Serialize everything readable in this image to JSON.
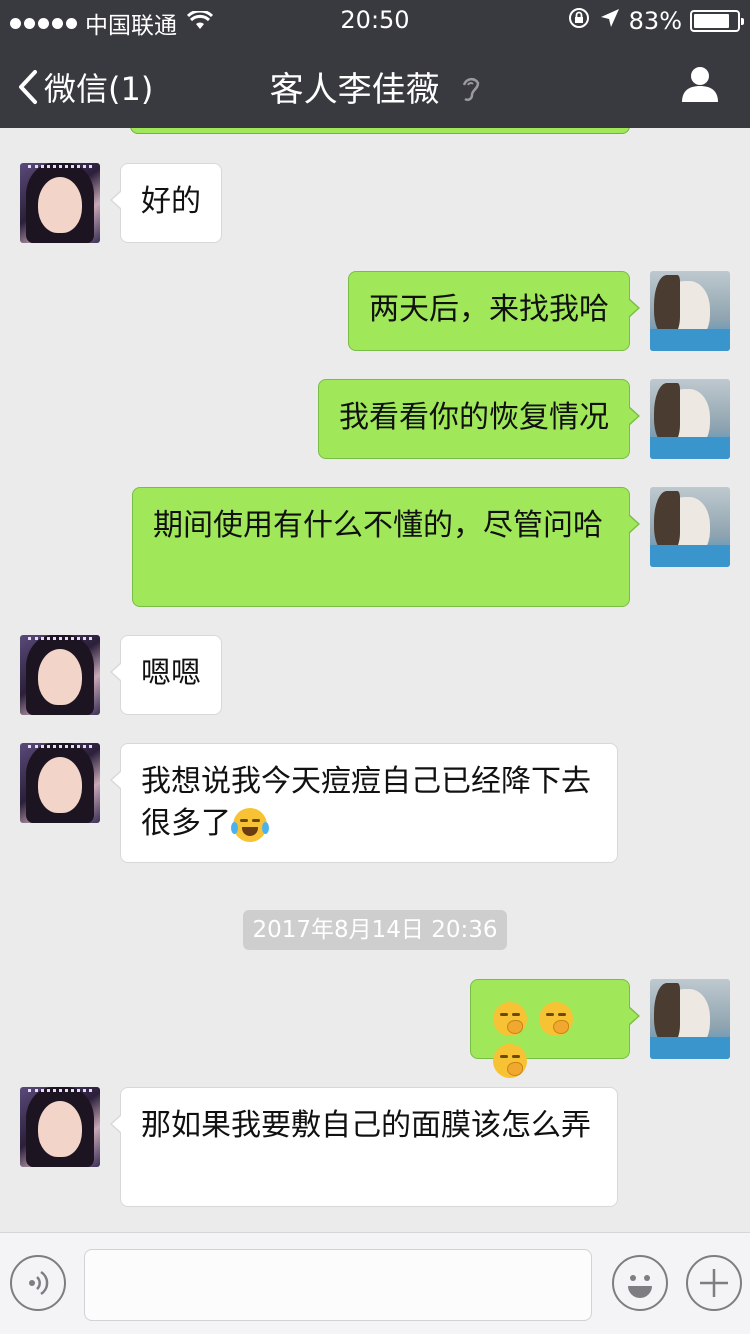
{
  "status_bar": {
    "carrier": "中国联通",
    "time": "20:50",
    "battery_text": "83%",
    "battery_level": 0.83,
    "icons": [
      "signal-dots-icon",
      "wifi-icon",
      "orientation-lock-icon",
      "location-arrow-icon",
      "battery-icon"
    ]
  },
  "nav": {
    "back_label": "微信(1)",
    "title": "客人李佳薇",
    "icons": [
      "chevron-left-icon",
      "ear-icon",
      "person-icon"
    ]
  },
  "messages": [
    {
      "side": "left",
      "text": "好的"
    },
    {
      "side": "right",
      "text": "两天后，来找我哈"
    },
    {
      "side": "right",
      "text": "我看看你的恢复情况"
    },
    {
      "side": "right",
      "text": "期间使用有什么不懂的，尽管问哈"
    },
    {
      "side": "left",
      "text": "嗯嗯"
    },
    {
      "side": "left",
      "text": "我想说我今天痘痘自己已经降下去很多了",
      "emoji": "laughing-crying-emoji"
    },
    {
      "side": "right",
      "text": "",
      "emoji": "hand-over-mouth-emoji x3"
    },
    {
      "side": "left",
      "text": "那如果我要敷自己的面膜该怎么弄"
    }
  ],
  "timestamp": "2017年8月14日 20:36",
  "input_bar": {
    "placeholder": "",
    "icons": [
      "voice-icon",
      "emoji-icon",
      "plus-icon"
    ]
  },
  "colors": {
    "header_bg": "#393a3f",
    "chat_bg": "#ebebeb",
    "sent_bubble": "#a0e75a",
    "received_bubble": "#ffffff",
    "timestamp_bg": "#cecece"
  }
}
